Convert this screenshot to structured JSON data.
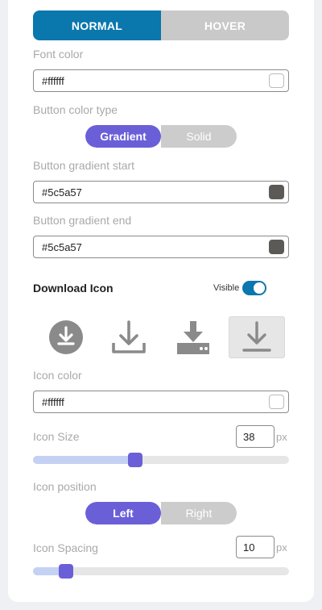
{
  "state_tabs": {
    "normal": "NORMAL",
    "hover": "HOVER",
    "active": "normal"
  },
  "font_color": {
    "label": "Font color",
    "value": "#ffffff",
    "swatch": "#ffffff"
  },
  "button_color_type": {
    "label": "Button color type",
    "options": [
      "Gradient",
      "Solid"
    ],
    "selected": "Gradient"
  },
  "gradient_start": {
    "label": "Button gradient start",
    "value": "#5c5a57",
    "swatch": "#5c5a57"
  },
  "gradient_end": {
    "label": "Button gradient end",
    "value": "#5c5a57",
    "swatch": "#5c5a57"
  },
  "download_icon": {
    "title": "Download Icon",
    "visible_label": "Visible",
    "visible": true,
    "icons": [
      "download-circle-icon",
      "download-tray-icon",
      "download-drive-icon",
      "download-underline-icon"
    ],
    "selected_icon": "download-underline-icon"
  },
  "icon_color": {
    "label": "Icon color",
    "value": "#ffffff",
    "swatch": "#ffffff"
  },
  "icon_size": {
    "label": "Icon Size",
    "value": "38",
    "unit": "px",
    "slider_fraction": 0.4
  },
  "icon_position": {
    "label": "Icon position",
    "options": [
      "Left",
      "Right"
    ],
    "selected": "Left"
  },
  "icon_spacing": {
    "label": "Icon Spacing",
    "value": "10",
    "unit": "px",
    "slider_fraction": 0.13
  },
  "colors": {
    "accent": "#6b5fd8",
    "primary": "#0a77ad",
    "icon_gray": "#8a8a8a"
  }
}
